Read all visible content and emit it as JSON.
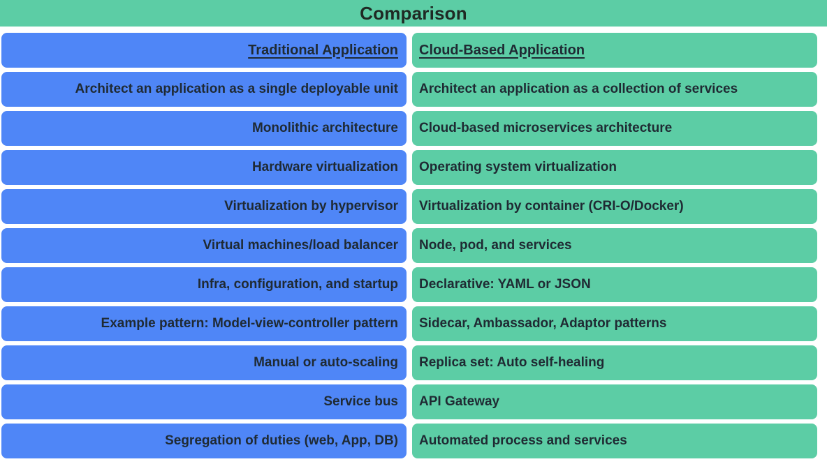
{
  "title": "Comparison",
  "columns": {
    "left_header": "Traditional Application",
    "right_header": "Cloud-Based Application"
  },
  "colors": {
    "header_banner": "#5ccda5",
    "left_column": "#4f86f7",
    "right_column": "#5ccda5",
    "text": "#1f2a33",
    "background": "#ffffff"
  },
  "rows": [
    {
      "left": "Architect an application as a single deployable unit",
      "right": "Architect an application as a collection of services"
    },
    {
      "left": "Monolithic architecture",
      "right": "Cloud-based microservices architecture"
    },
    {
      "left": "Hardware virtualization",
      "right": "Operating system virtualization"
    },
    {
      "left": "Virtualization by hypervisor",
      "right": "Virtualization by container (CRI-O/Docker)"
    },
    {
      "left": "Virtual machines/load balancer",
      "right": "Node, pod, and services"
    },
    {
      "left": "Infra, configuration, and startup",
      "right": "Declarative: YAML or JSON"
    },
    {
      "left": "Example pattern: Model-view-controller pattern",
      "right": "Sidecar, Ambassador, Adaptor patterns"
    },
    {
      "left": "Manual or auto-scaling",
      "right": "Replica set: Auto self-healing"
    },
    {
      "left": "Service bus",
      "right": "API Gateway"
    },
    {
      "left": "Segregation of duties (web, App, DB)",
      "right": "Automated process and services"
    }
  ]
}
